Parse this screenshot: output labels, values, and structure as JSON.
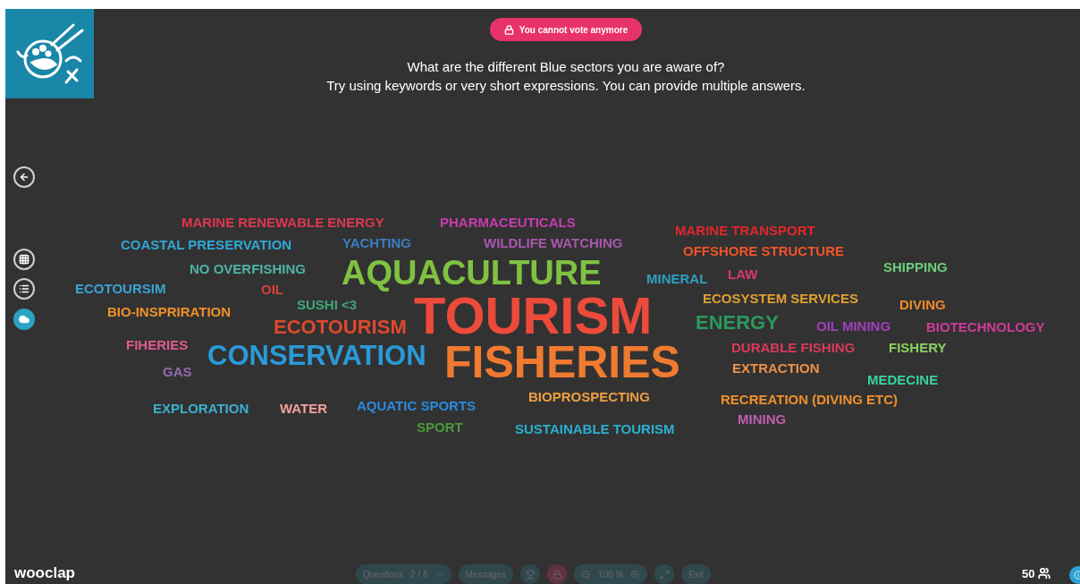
{
  "banner": {
    "text": "You cannot vote anymore"
  },
  "question": {
    "title": "What are the different Blue sectors you are aware of?",
    "instructions": "Try using keywords or very short expressions. You can provide multiple answers."
  },
  "side_nav": [
    {
      "kind": "back",
      "selected": false
    },
    {
      "kind": "grid",
      "selected": false
    },
    {
      "kind": "list",
      "selected": false
    },
    {
      "kind": "cloud",
      "selected": true
    }
  ],
  "word_cloud": [
    {
      "text": "MARINE RENEWABLE ENERGY",
      "kind": "small",
      "color": "#e0364f"
    },
    {
      "text": "PHARMACEUTICALS",
      "kind": "small",
      "color": "#c93cb0"
    },
    {
      "text": "MARINE TRANSPORT",
      "kind": "small",
      "color": "#e0282e"
    },
    {
      "text": "COASTAL PRESERVATION",
      "kind": "small",
      "color": "#2fa8d8"
    },
    {
      "text": "YACHTING",
      "kind": "small",
      "color": "#3a7fc1"
    },
    {
      "text": "WILDLIFE WATCHING",
      "kind": "small",
      "color": "#a857b0"
    },
    {
      "text": "OFFSHORE STRUCTURE",
      "kind": "small",
      "color": "#f0542a"
    },
    {
      "text": "NO OVERFISHING",
      "kind": "small",
      "color": "#4fb3a6"
    },
    {
      "text": "AQUACULTURE",
      "kind": "xlarge",
      "color": "#7fc241"
    },
    {
      "text": "SHIPPING",
      "kind": "small",
      "color": "#6ccf7c"
    },
    {
      "text": "MINERAL",
      "kind": "small",
      "color": "#2f9fc0"
    },
    {
      "text": "LAW",
      "kind": "small",
      "color": "#d83a6a"
    },
    {
      "text": "ECOTOURSIM",
      "kind": "small",
      "color": "#3aa3d6"
    },
    {
      "text": "OIL",
      "kind": "small",
      "color": "#d8403a"
    },
    {
      "text": "SUSHI <3",
      "kind": "small",
      "color": "#3fa878"
    },
    {
      "text": "ECOSYSTEM SERVICES",
      "kind": "small",
      "color": "#e0a030"
    },
    {
      "text": "DIVING",
      "kind": "small",
      "color": "#f08a2a"
    },
    {
      "text": "BIO-INSPRIRATION",
      "kind": "small",
      "color": "#f0902a"
    },
    {
      "text": "ECOTOURISM",
      "kind": "medium",
      "color": "#e0482e"
    },
    {
      "text": "TOURISM",
      "kind": "giant",
      "color": "#ec4a3a"
    },
    {
      "text": "ENERGY",
      "kind": "medium",
      "color": "#2a9a5a"
    },
    {
      "text": "OIL MINING",
      "kind": "small",
      "color": "#a040c0"
    },
    {
      "text": "BIOTECHNOLOGY",
      "kind": "small",
      "color": "#d03a9a"
    },
    {
      "text": "FIHERIES",
      "kind": "small",
      "color": "#e05a90"
    },
    {
      "text": "CONSERVATION",
      "kind": "large",
      "color": "#2a9ad8"
    },
    {
      "text": "FISHERIES",
      "kind": "huge",
      "color": "#f07a30"
    },
    {
      "text": "DURABLE FISHING",
      "kind": "small",
      "color": "#d83a5a"
    },
    {
      "text": "FISHERY",
      "kind": "small",
      "color": "#8ad060"
    },
    {
      "text": "GAS",
      "kind": "small",
      "color": "#9a6ab0"
    },
    {
      "text": "EXTRACTION",
      "kind": "small",
      "color": "#f0904a"
    },
    {
      "text": "MEDECINE",
      "kind": "small",
      "color": "#3ad0a0"
    },
    {
      "text": "EXPLORATION",
      "kind": "small",
      "color": "#3ab0d0"
    },
    {
      "text": "WATER",
      "kind": "small",
      "color": "#f0a0a0"
    },
    {
      "text": "AQUATIC SPORTS",
      "kind": "small",
      "color": "#2a8ae0"
    },
    {
      "text": "BIOPROSPECTING",
      "kind": "small",
      "color": "#f0a040"
    },
    {
      "text": "RECREATION (DIVING ETC)",
      "kind": "small",
      "color": "#f0902a"
    },
    {
      "text": "MINING",
      "kind": "small",
      "color": "#c060b0"
    },
    {
      "text": "SPORT",
      "kind": "small",
      "color": "#4a9a3a"
    },
    {
      "text": "SUSTAINABLE TOURISM",
      "kind": "small",
      "color": "#2ab0d0"
    }
  ],
  "footer": {
    "brand": "wooclap",
    "participants": "50"
  },
  "toolbar": {
    "disabled": true,
    "questions_label": "Questions",
    "question_counter": "2 / 6",
    "messages": "Messages",
    "zoom": "100 %",
    "exit": "Exit"
  }
}
